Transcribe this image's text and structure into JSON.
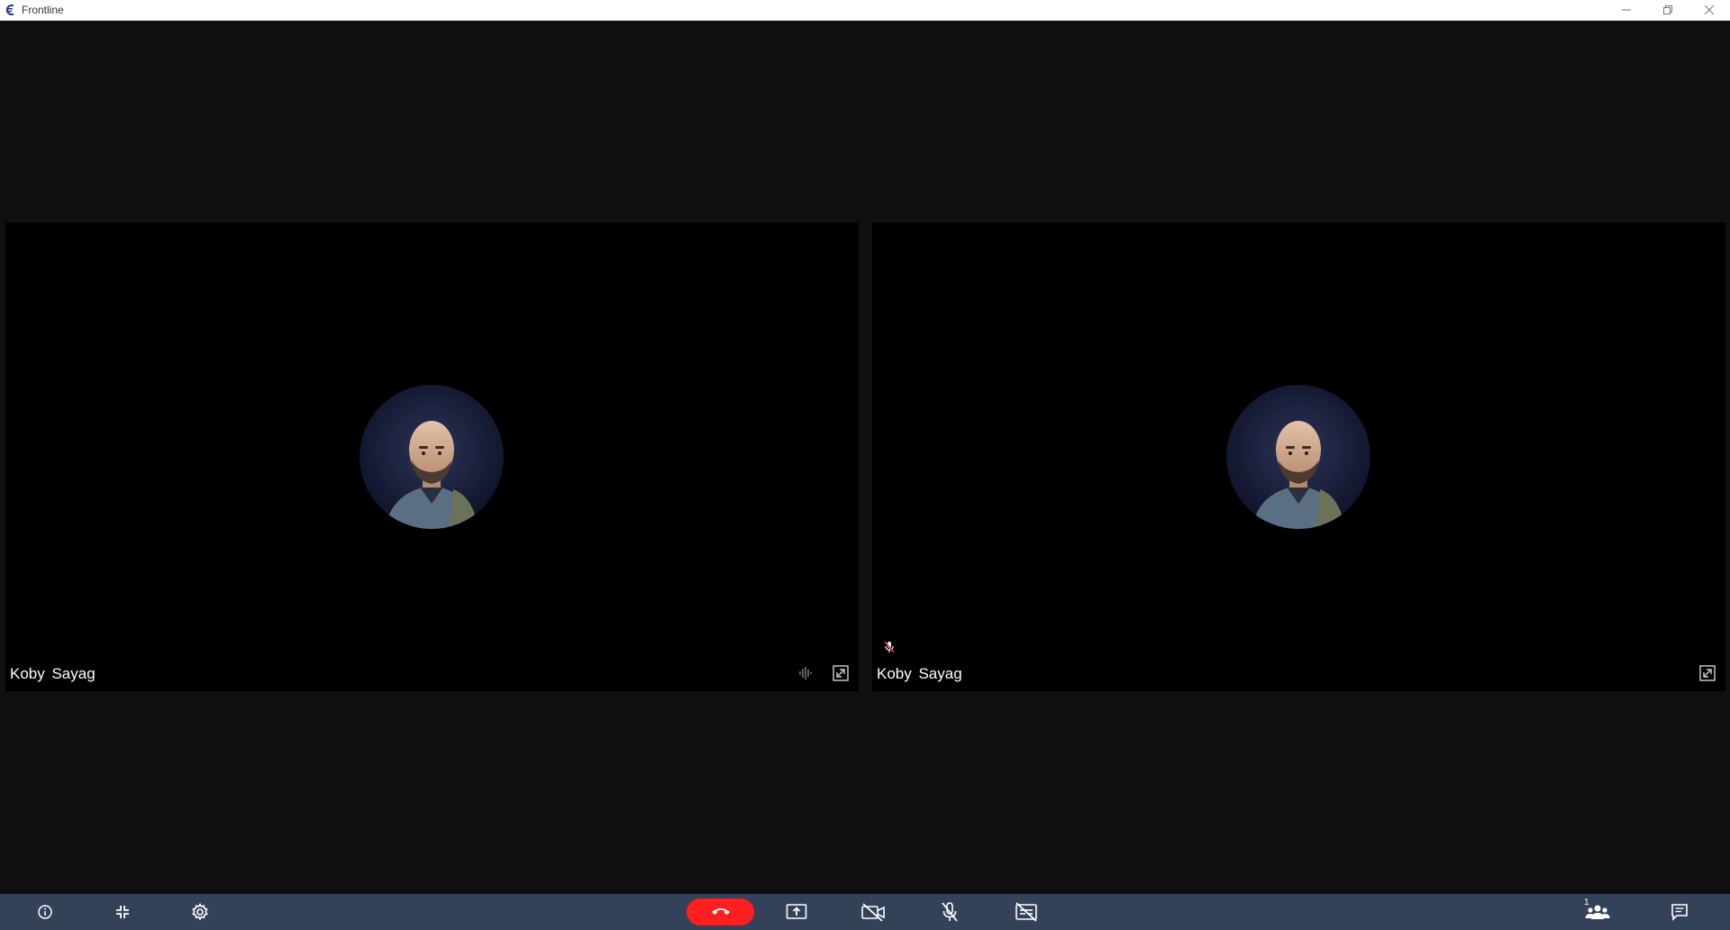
{
  "window": {
    "title": "Frontline"
  },
  "participants": [
    {
      "name": "Koby Sayag",
      "mic_muted": false,
      "audio_indicator": "audio-level-icon"
    },
    {
      "name": "Koby Sayag",
      "mic_muted": true
    }
  ],
  "toolbar": {
    "participants_count": "1"
  },
  "colors": {
    "toolbar_bg": "#334159",
    "hangup": "#ff1f1f",
    "stage_bg": "#0f0f0f",
    "tile_bg": "#000000"
  }
}
